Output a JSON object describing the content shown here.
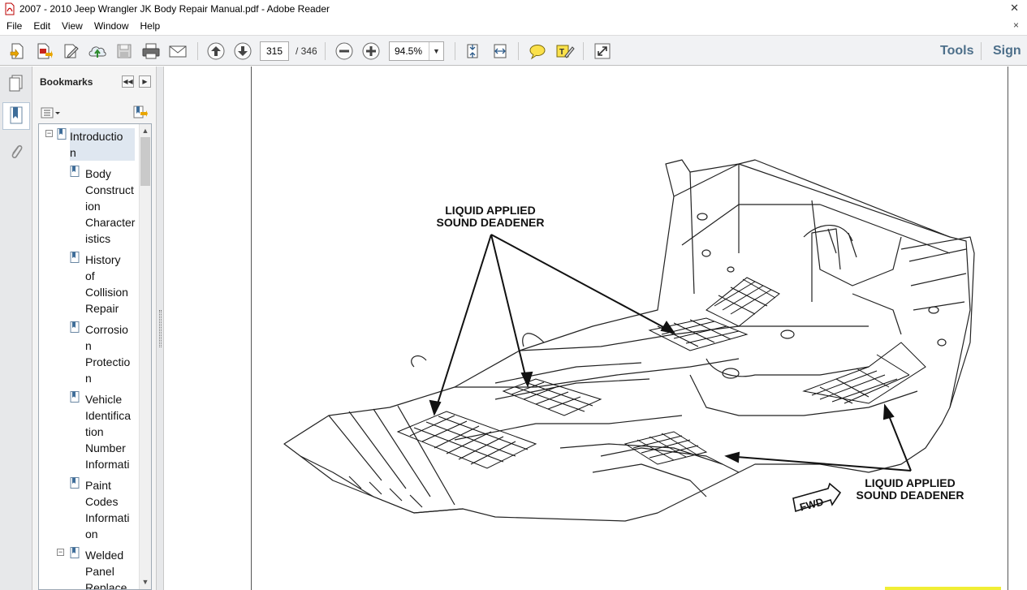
{
  "window": {
    "title": "2007 - 2010 Jeep Wrangler JK Body Repair Manual.pdf - Adobe Reader",
    "close_glyph": "✕"
  },
  "menu": {
    "items": [
      "File",
      "Edit",
      "View",
      "Window",
      "Help"
    ],
    "close_glyph": "×"
  },
  "toolbar": {
    "page_current": "315",
    "page_total": "/ 346",
    "zoom": "94.5%",
    "tools_label": "Tools",
    "sign_label": "Sign",
    "icons": [
      "create-pdf-icon",
      "export-pdf-icon",
      "edit-icon",
      "upload-icon",
      "save-icon",
      "print-icon",
      "email-icon",
      "previous-page-icon",
      "next-page-icon",
      "zoom-out-icon",
      "zoom-in-icon",
      "fit-page-icon",
      "fit-width-icon",
      "comment-icon",
      "highlight-icon",
      "read-mode-icon"
    ]
  },
  "bookmarks": {
    "title": "Bookmarks",
    "items": [
      {
        "text": "Introductio\nn",
        "expanded": true,
        "selected": true
      },
      {
        "text": "Body\nConstruct\nion\nCharacter\nistics"
      },
      {
        "text": "History\nof\nCollision\nRepair"
      },
      {
        "text": "Corrosio\nn\nProtectio\nn"
      },
      {
        "text": "Vehicle\nIdentifica\ntion\nNumber\nInformati"
      },
      {
        "text": "Paint\nCodes\nInformati\non"
      },
      {
        "text": "Welded\nPanel\nReplace",
        "expanded": true
      }
    ]
  },
  "document": {
    "label_top_line1": "LIQUID APPLIED",
    "label_top_line2": "SOUND DEADENER",
    "label_bottom_line1": "LIQUID APPLIED",
    "label_bottom_line2": "SOUND DEADENER",
    "fwd_label": "FWD"
  }
}
